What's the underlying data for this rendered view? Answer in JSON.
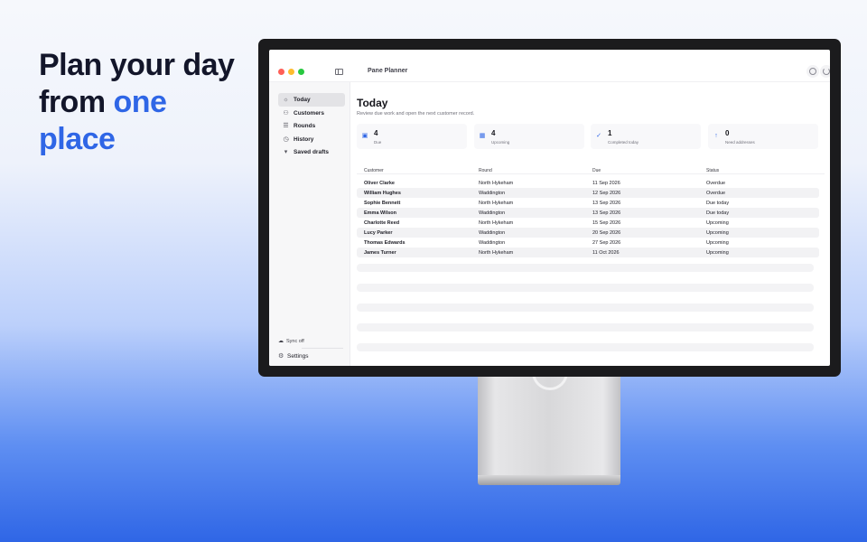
{
  "hero": {
    "line1": "Plan your day",
    "line2_a": "from ",
    "line2_b": "one",
    "line3": "place"
  },
  "window": {
    "app_title": "Pane Planner"
  },
  "sidebar": {
    "items": [
      {
        "label": "Today",
        "icon": "sun-icon"
      },
      {
        "label": "Customers",
        "icon": "people-icon"
      },
      {
        "label": "Rounds",
        "icon": "list-icon"
      },
      {
        "label": "History",
        "icon": "clock-icon"
      },
      {
        "label": "Saved drafts",
        "icon": "bookmark-icon"
      }
    ],
    "sync_status": "Sync off",
    "settings_label": "Settings"
  },
  "main": {
    "title": "Today",
    "subtitle": "Review due work and open the next customer record."
  },
  "stats": [
    {
      "value": "4",
      "label": "Due",
      "icon": "calendar-icon"
    },
    {
      "value": "4",
      "label": "Upcoming",
      "icon": "calendar-icon"
    },
    {
      "value": "1",
      "label": "Completed today",
      "icon": "check-icon"
    },
    {
      "value": "0",
      "label": "Need addresses",
      "icon": "arrow-up-icon"
    }
  ],
  "table": {
    "columns": [
      "Customer",
      "Round",
      "Due",
      "Status"
    ],
    "rows": [
      [
        "Oliver Clarke",
        "North Hykeham",
        "11 Sep 2026",
        "Overdue"
      ],
      [
        "William Hughes",
        "Waddington",
        "12 Sep 2026",
        "Overdue"
      ],
      [
        "Sophie Bennett",
        "North Hykeham",
        "13 Sep 2026",
        "Due today"
      ],
      [
        "Emma Wilson",
        "Waddington",
        "13 Sep 2026",
        "Due today"
      ],
      [
        "Charlotte Reed",
        "North Hykeham",
        "15 Sep 2026",
        "Upcoming"
      ],
      [
        "Lucy Parker",
        "Waddington",
        "20 Sep 2026",
        "Upcoming"
      ],
      [
        "Thomas Edwards",
        "Waddington",
        "27 Sep 2026",
        "Upcoming"
      ],
      [
        "James Turner",
        "North Hykeham",
        "11 Oct 2026",
        "Upcoming"
      ]
    ]
  },
  "colors": {
    "accent": "#2f66e6",
    "text": "#13162a"
  }
}
